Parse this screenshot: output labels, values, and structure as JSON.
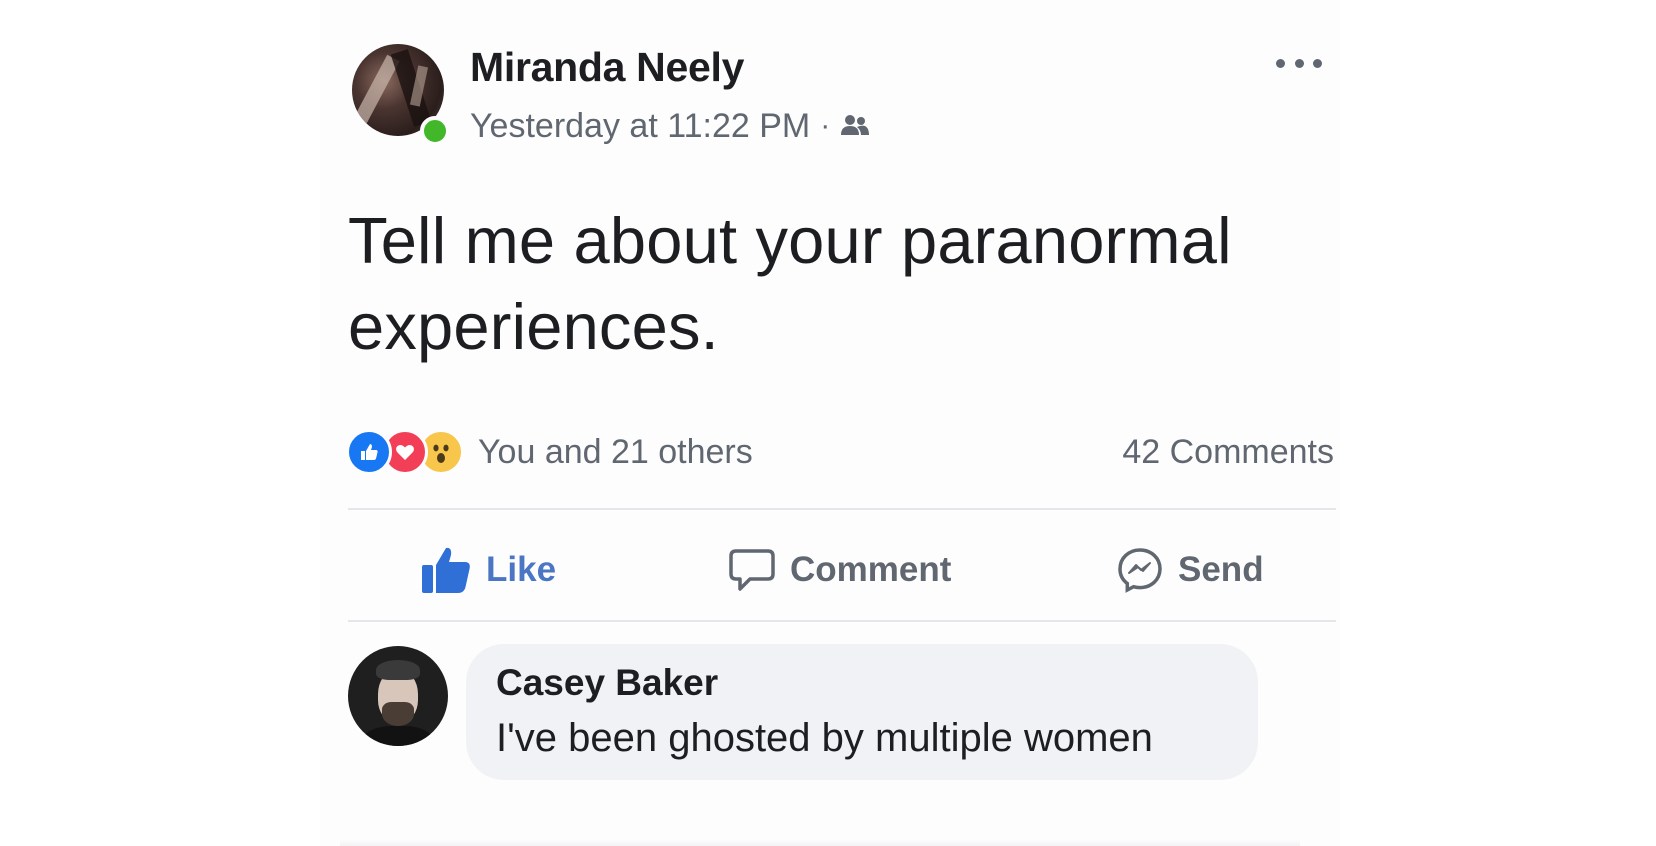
{
  "post": {
    "author": "Miranda Neely",
    "timestamp": "Yesterday at 11:22 PM",
    "separator": "·",
    "audience_icon": "friends-icon",
    "text": "Tell me about your paranormal experiences.",
    "reactions": {
      "types": [
        "like",
        "love",
        "wow"
      ],
      "summary": "You and 21 others"
    },
    "comment_count": "42 Comments"
  },
  "actions": {
    "like_label": "Like",
    "comment_label": "Comment",
    "send_label": "Send"
  },
  "comment": {
    "author": "Casey Baker",
    "text": "I've been ghosted by multiple women"
  },
  "colors": {
    "like_blue": "#1877f2",
    "love_red": "#f33e58",
    "wow_yellow": "#f7c64a",
    "online_green": "#42b72a",
    "secondary_text": "#606770"
  }
}
